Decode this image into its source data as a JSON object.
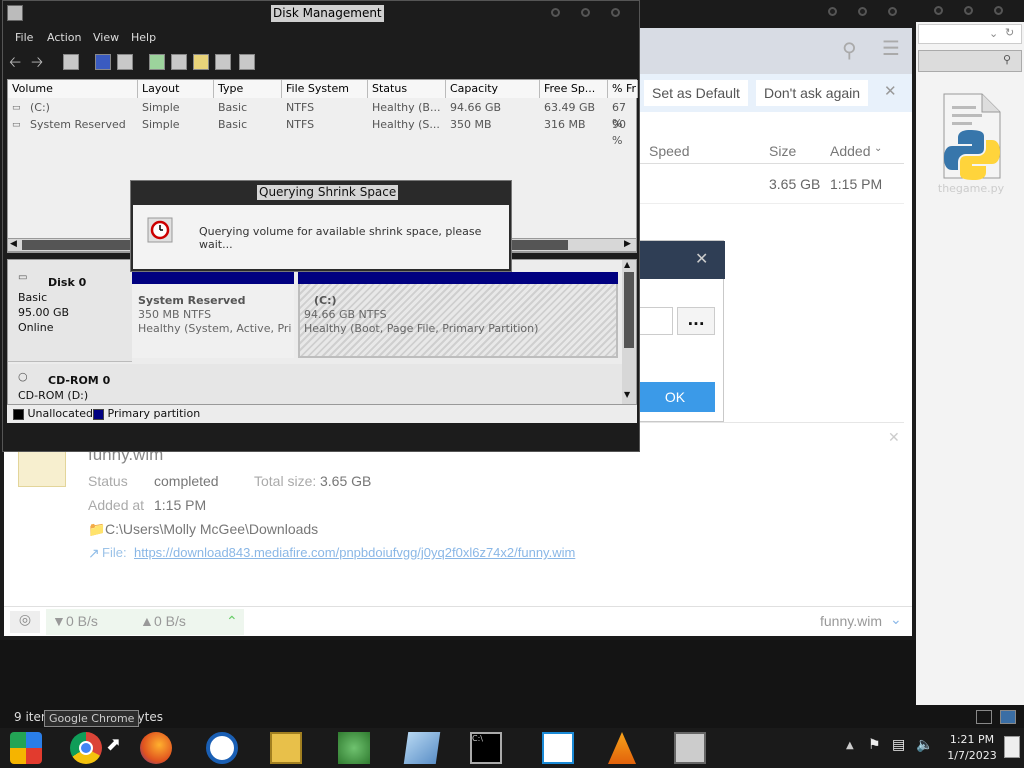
{
  "explorer": {
    "status_text": "9 items",
    "status_right": "cted  0 bytes",
    "status_full": "9 items   Selected  0 bytes"
  },
  "download_manager": {
    "banner_set_default": "Set as Default",
    "banner_dont_ask": "Don't ask again",
    "columns": [
      "Speed",
      "Size",
      "Added"
    ],
    "row": {
      "size": "3.65 GB",
      "added": "1:15 PM"
    },
    "detail": {
      "filename": "funny.wim",
      "status_label": "Status",
      "status_value": "completed",
      "total_label": "Total size:",
      "total_value": "3.65 GB",
      "added_label": "Added at",
      "added_value": "1:15 PM",
      "folder": "C:\\Users\\Molly McGee\\Downloads",
      "file_label": "File:",
      "file_url": "https://download843.mediafire.com/pnpbdoiufvgg/j0yq2f0xl6z74x2/funny.wim"
    },
    "bottom": {
      "down": "0 B/s",
      "up": "0 B/s",
      "current": "funny.wim"
    },
    "dialog_ok": "OK",
    "dialog_dots": "..."
  },
  "disk_management": {
    "title": "Disk Management",
    "menu": [
      "File",
      "Action",
      "View",
      "Help"
    ],
    "columns": [
      "Volume",
      "Layout",
      "Type",
      "File System",
      "Status",
      "Capacity",
      "Free Sp...",
      "% Fr"
    ],
    "rows": [
      [
        "(C:)",
        "Simple",
        "Basic",
        "NTFS",
        "Healthy (B...",
        "94.66 GB",
        "63.49 GB",
        "67 %"
      ],
      [
        "System Reserved",
        "Simple",
        "Basic",
        "NTFS",
        "Healthy (S...",
        "350 MB",
        "316 MB",
        "90 %"
      ]
    ],
    "disk0": {
      "name": "Disk 0",
      "kind": "Basic",
      "size": "95.00 GB",
      "state": "Online"
    },
    "part1": {
      "name": "System Reserved",
      "size": "350 MB NTFS",
      "status": "Healthy (System, Active, Prin"
    },
    "part2": {
      "name": "(C:)",
      "size": "94.66 GB NTFS",
      "status": "Healthy (Boot, Page File, Primary Partition)"
    },
    "cdrom": {
      "name": "CD-ROM 0",
      "sub": "CD-ROM (D:)"
    },
    "legend": {
      "unallocated": "Unallocated",
      "primary": "Primary partition"
    },
    "colors": {
      "primary": "#000080",
      "unallocated": "#000000"
    }
  },
  "shrink_dialog": {
    "title": "Querying Shrink Space",
    "message": "Querying volume for available shrink space, please wait..."
  },
  "desktop": {
    "file_name": "thegame.py"
  },
  "taskbar": {
    "tooltip": "Google Chrome",
    "time": "1:21 PM",
    "date": "1/7/2023"
  }
}
